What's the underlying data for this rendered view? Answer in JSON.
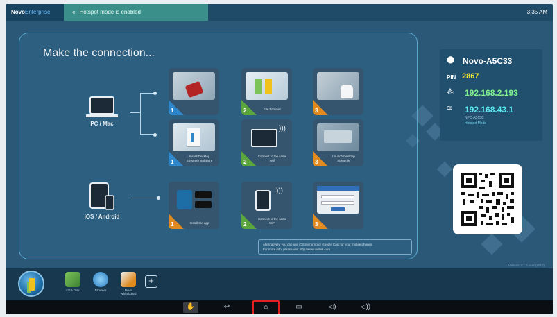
{
  "topbar": {
    "brand": "Novo",
    "brand_sub": "Enterprise",
    "hotspot_message": "Hotspot mode is enabled",
    "time": "3:35 AM"
  },
  "panel": {
    "title": "Make the connection...",
    "pc_label": "PC / Mac",
    "mobile_label": "iOS / Android",
    "pc_row1": [
      {
        "step": "1",
        "caption": ""
      },
      {
        "step": "2",
        "caption": "File Browser"
      },
      {
        "step": "3",
        "caption": ""
      }
    ],
    "pc_row2": [
      {
        "step": "1",
        "caption": "Install Desktop Streamer Software"
      },
      {
        "step": "2",
        "caption": "Connect to the same Wifi"
      },
      {
        "step": "3",
        "caption": "Launch Desktop Streamer"
      }
    ],
    "mobile_row": [
      {
        "step": "1",
        "caption": "Install the app"
      },
      {
        "step": "2",
        "caption": "Connect to the same WiFi"
      },
      {
        "step": "3",
        "caption": ""
      }
    ],
    "footnote_line1": "Alternatively, you can use iOS mirroring or Google Cast for your mobile phones.",
    "footnote_line2": "For more info, please visit http://www.vivitek.com"
  },
  "info": {
    "device_name": "Novo-A5C33",
    "pin_label": "PIN",
    "pin": "2867",
    "ip_lan": "192.168.2.193",
    "ip_hotspot": "192.168.43.1",
    "ssid": "NPC-A5C33",
    "hotspot_mode": "Hotspot Mode"
  },
  "version": "Version: 2.1.0.xxxx (2015)",
  "dock": {
    "apps": [
      {
        "label": "USB Disk",
        "icon": "usb-disk-icon"
      },
      {
        "label": "Browser",
        "icon": "browser-icon"
      },
      {
        "label": "Novo Whiteboard",
        "icon": "whiteboard-icon"
      }
    ],
    "add_label": "+"
  },
  "navbar": {
    "items": [
      "screenshot-icon",
      "back-icon",
      "home-icon",
      "recent-apps-icon",
      "volume-down-icon",
      "volume-up-icon"
    ]
  },
  "colors": {
    "screen_bg": "#2b5877",
    "pin": "#f0e82e",
    "ip_lan": "#7ef28e",
    "ip_hotspot": "#5ee8f0",
    "highlight": "#e22020"
  }
}
